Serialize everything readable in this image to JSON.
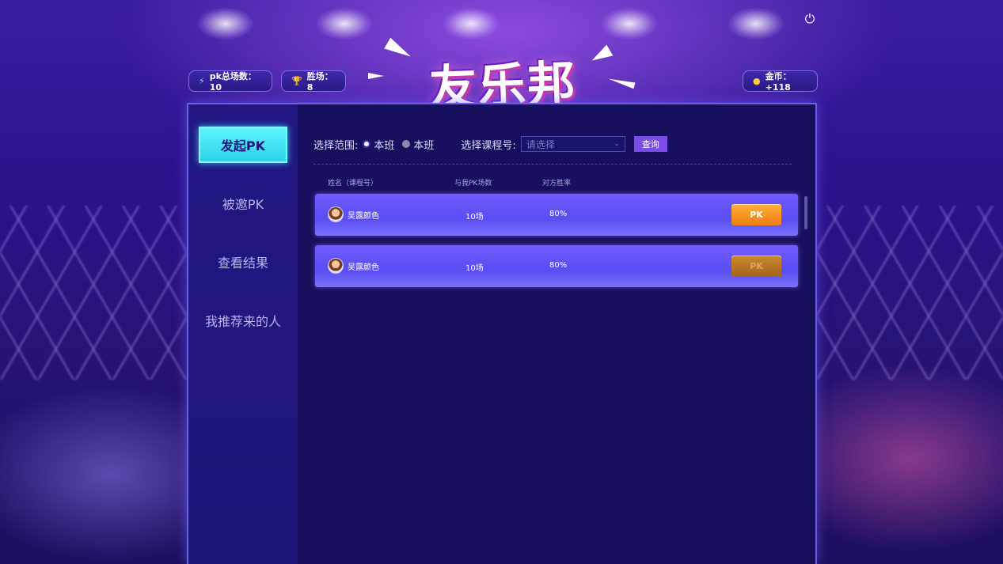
{
  "header": {
    "pk_total_label": "pk总场数：10",
    "wins_label": "胜场：8",
    "logo_text": "友乐邦",
    "coins_label": "金币：+118"
  },
  "sidebar": {
    "items": [
      {
        "label": "发起PK",
        "active": true
      },
      {
        "label": "被邀PK",
        "active": false
      },
      {
        "label": "查看结果",
        "active": false
      },
      {
        "label": "我推荐来的人",
        "active": false
      }
    ]
  },
  "filter": {
    "range_label": "选择范围:",
    "radio_options": [
      "本班",
      "本班"
    ],
    "course_label": "选择课程号:",
    "select_placeholder": "请选择",
    "query_label": "查询"
  },
  "table": {
    "columns": [
      "姓名（课程号）",
      "与我PK场数",
      "对方胜率"
    ],
    "rows": [
      {
        "name": "吴露颜色",
        "count": "10场",
        "rate": "80%",
        "action": "PK",
        "enabled": true
      },
      {
        "name": "吴露颜色",
        "count": "10场",
        "rate": "80%",
        "action": "PK",
        "enabled": false
      }
    ]
  },
  "colors": {
    "accent_cyan": "#5ef3ff",
    "row_purple": "#6f5cff",
    "pk_orange": "#f07a12",
    "query_purple": "#7a4de6"
  },
  "icons": [
    "bolt-icon",
    "trophy-icon",
    "coin-icon",
    "power-icon",
    "chevron-down-icon"
  ]
}
